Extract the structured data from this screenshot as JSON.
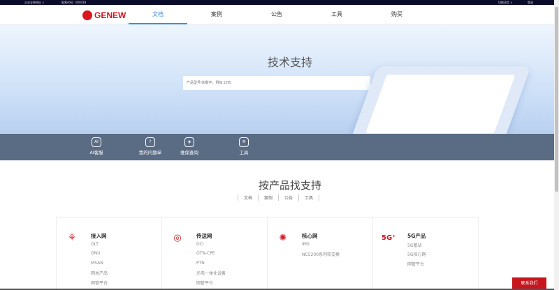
{
  "topbar": {
    "site_select": "企业全称网址 ∨",
    "stock": "股票代码：000418",
    "language": "切换语言 ∨",
    "login": "登录"
  },
  "header": {
    "logo": "GENEW",
    "nav": [
      "文档",
      "案例",
      "公告",
      "工具",
      "购买"
    ],
    "active": "文档"
  },
  "hero": {
    "title": "技术支持",
    "search_placeholder": "产品型号/关键字，例如:1295"
  },
  "quick": [
    {
      "icon": "AI",
      "label": "AI客服"
    },
    {
      "icon": "?",
      "label": "我的问题单"
    },
    {
      "icon": "◈",
      "label": "维保查询"
    },
    {
      "icon": "✲",
      "label": "工具"
    }
  ],
  "section": {
    "title": "按产品找支持",
    "tabs": [
      "文档",
      "案例",
      "公告",
      "工具"
    ]
  },
  "cards": [
    {
      "icon": "⚘",
      "title": "接入网",
      "items": [
        "OLT",
        "ONU",
        "MSAN",
        "网关产品",
        "网管平台"
      ]
    },
    {
      "icon": "◎",
      "title": "传送网",
      "items": [
        "DCI",
        "OTN-CPE",
        "PTN",
        "光电一体化设备",
        "网管平台"
      ]
    },
    {
      "icon": "✺",
      "title": "核心网",
      "items": [
        "IMS",
        "NC5200系列软交换"
      ]
    },
    {
      "icon": "5G⁺",
      "title": "5G产品",
      "items": [
        "5G基站",
        "5G核心网",
        "网管平台"
      ]
    }
  ],
  "contact": "联系我们",
  "colors": {
    "brand": "#d7161e",
    "accent": "#3a8ee6",
    "band": "#5a6b84"
  }
}
